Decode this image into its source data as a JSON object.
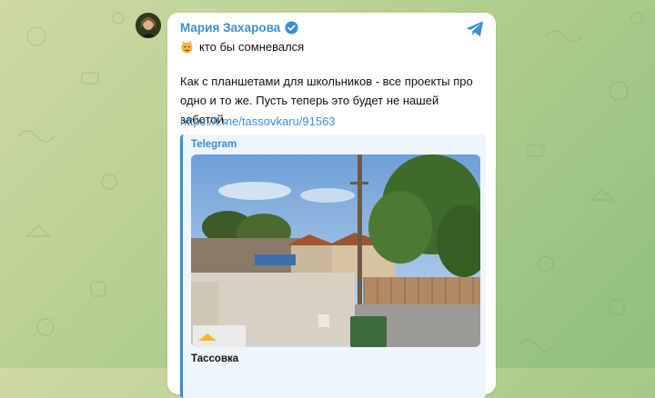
{
  "post": {
    "author_name": "Мария Захарова",
    "text_line1": "кто бы сомневался",
    "text_line2": "Как с планшетами для школьников - все проекты про одно и то же. Пусть теперь это будет не нашей заботой.",
    "link": "https://t.me/tassovkaru/91563",
    "icons": {
      "verified": "verified-badge-icon",
      "emoji": "smirking-cat-emoji",
      "share": "telegram-plane-icon"
    }
  },
  "preview": {
    "site_name": "Telegram",
    "title": "Тассовка",
    "image": "street-view-photo"
  },
  "colors": {
    "accent": "#3b8fd3",
    "background": "#b3cf8e",
    "card": "#ffffff",
    "preview_bg": "#eef5fc"
  }
}
